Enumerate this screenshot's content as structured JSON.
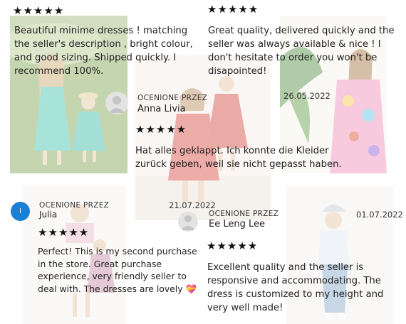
{
  "reviews": [
    {
      "stars": "★★★★★",
      "text": "Beautiful minime dresses ! matching the seller's description , bright colour, and good sizing. Shipped quickly.  I recommend 100%."
    },
    {
      "stars": "★★★★★",
      "text": "Great quality, delivered quickly and the seller was always available  & nice ! I don't hesitate to order you won't be disapointed!",
      "date": "26.05.2022"
    },
    {
      "rated_by": "OCENIONE PRZEZ",
      "name": "Anna Livia",
      "stars": "★★★★★",
      "text": "Hat alles geklappt. Ich konnte die Kleider zurück geben, weil sie nicht gepasst haben.",
      "date": "21.07.2022"
    },
    {
      "avatar_letter": "I",
      "rated_by": "OCENIONE PRZEZ",
      "name": "Julia",
      "stars": "★★★★★",
      "text": "Perfect! This is my second purchase in the store. Great purchase experience, very friendly seller to deal with. The dresses are lovely 💝"
    },
    {
      "rated_by": "OCENIONE PRZEZ",
      "name": "Ee Leng Lee",
      "stars": "★★★★★",
      "text": "Excellent quality and the seller is responsive and accommodating. The dress is customized to my height and very well made!",
      "date": "01.07.2022"
    }
  ],
  "colors": {
    "avatar_blue": "#1b7fd6",
    "star": "#111111",
    "text": "#222222"
  },
  "icons": [
    "star-icon",
    "avatar-placeholder-icon"
  ]
}
